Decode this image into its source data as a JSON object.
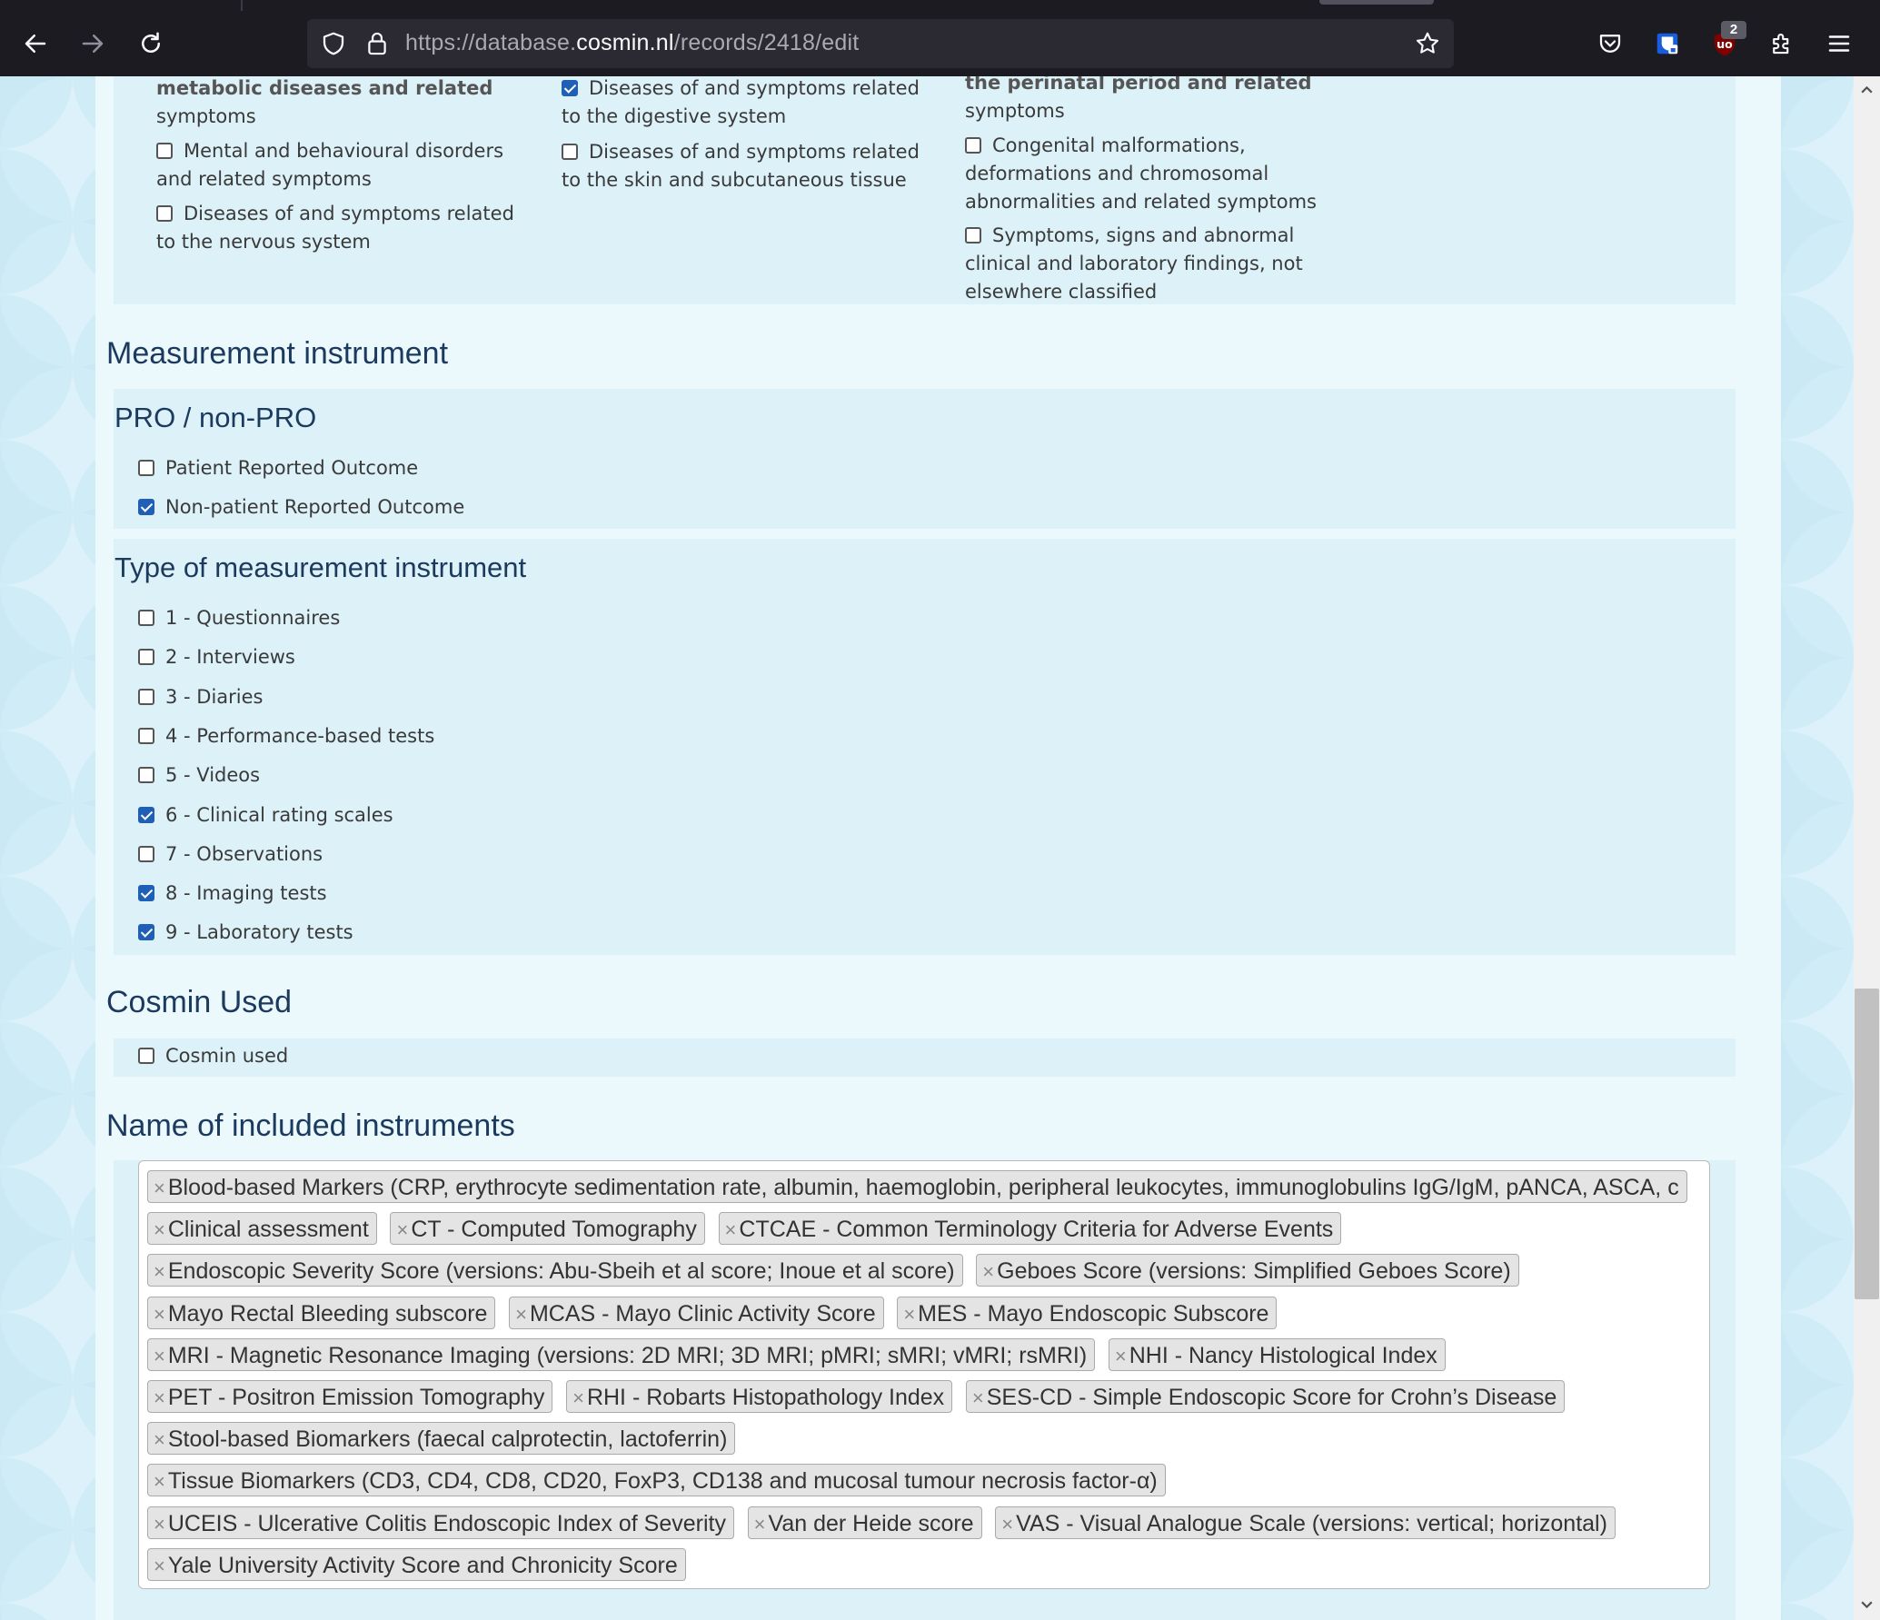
{
  "browser": {
    "url_prefix": "https://database.",
    "url_domain": "cosmin.nl",
    "url_path": "/records/2418/edit",
    "ublock_badge": "2"
  },
  "icd_partial": {
    "col1": [
      {
        "label": "metabolic diseases and related symptoms",
        "checked": false,
        "partial_text": "metabolic diseases and related",
        "line2": "symptoms"
      },
      {
        "label": "Mental and behavioural disorders and related symptoms",
        "checked": false,
        "line1": "Mental and behavioural disorders",
        "line2": "and related symptoms"
      },
      {
        "label": "Diseases of and symptoms related to the nervous system",
        "checked": false,
        "line1": "Diseases of and symptoms related",
        "line2": "to the nervous system"
      }
    ],
    "col2": [
      {
        "label": "Diseases of and symptoms related to the digestive system",
        "checked": true,
        "line1": "Diseases of and symptoms related",
        "line2": "to the digestive system"
      },
      {
        "label": "Diseases of and symptoms related to the skin and subcutaneous tissue",
        "checked": false,
        "line1": "Diseases of and symptoms related",
        "line2": "to the skin and subcutaneous tissue"
      }
    ],
    "col3": [
      {
        "partial_text": "the perinatal period and related",
        "line2": "symptoms"
      },
      {
        "checked": false,
        "line1": "Congenital malformations,",
        "line2": "deformations and chromosomal",
        "line3": "abnormalities and related symptoms"
      },
      {
        "checked": false,
        "line1": "Symptoms, signs and abnormal",
        "line2": "clinical and laboratory findings, not",
        "line3": "elsewhere classified"
      }
    ]
  },
  "measurement_instrument": {
    "heading": "Measurement instrument",
    "pro": {
      "heading": "PRO / non-PRO",
      "options": [
        {
          "label": "Patient Reported Outcome",
          "checked": false
        },
        {
          "label": "Non-patient Reported Outcome",
          "checked": true
        }
      ]
    },
    "type": {
      "heading": "Type of measurement instrument",
      "options": [
        {
          "label": "1 - Questionnaires",
          "checked": false
        },
        {
          "label": "2 - Interviews",
          "checked": false
        },
        {
          "label": "3 - Diaries",
          "checked": false
        },
        {
          "label": "4 - Performance-based tests",
          "checked": false
        },
        {
          "label": "5 - Videos",
          "checked": false
        },
        {
          "label": "6 - Clinical rating scales",
          "checked": true
        },
        {
          "label": "7 - Observations",
          "checked": false
        },
        {
          "label": "8 - Imaging tests",
          "checked": true
        },
        {
          "label": "9 - Laboratory tests",
          "checked": true
        }
      ]
    }
  },
  "cosmin": {
    "heading": "Cosmin Used",
    "option": {
      "label": "Cosmin used",
      "checked": false
    }
  },
  "included": {
    "heading": "Name of included instruments",
    "remove_glyph": "×",
    "tags": [
      "Blood-based Markers (CRP, erythrocyte sedimentation rate, albumin, haemoglobin, peripheral leukocytes, immunoglobulins IgG/IgM, pANCA, ASCA, c",
      "Clinical assessment",
      "CT - Computed Tomography",
      "CTCAE - Common Terminology Criteria for Adverse Events",
      "Endoscopic Severity Score (versions: Abu-Sbeih et al score; Inoue et al score)",
      "Geboes Score (versions: Simplified Geboes Score)",
      "Mayo Rectal Bleeding subscore",
      "MCAS - Mayo Clinic Activity Score",
      "MES - Mayo Endoscopic Subscore",
      "MRI - Magnetic Resonance Imaging (versions: 2D MRI; 3D MRI; pMRI; sMRI; vMRI; rsMRI)",
      "NHI - Nancy Histological Index",
      "PET - Positron Emission Tomography",
      "RHI - Robarts Histopathology Index",
      "SES-CD - Simple Endoscopic Score for Crohn’s Disease",
      "Stool-based Biomarkers (faecal calprotectin, lactoferrin)",
      "Tissue Biomarkers (CD3, CD4, CD8, CD20, FoxP3, CD138 and mucosal tumour necrosis factor-α)",
      "UCEIS - Ulcerative Colitis Endoscopic Index of Severity",
      "Van der Heide score",
      "VAS - Visual Analogue Scale (versions: vertical; horizontal)",
      "Yale University Activity Score and Chronicity Score"
    ]
  }
}
